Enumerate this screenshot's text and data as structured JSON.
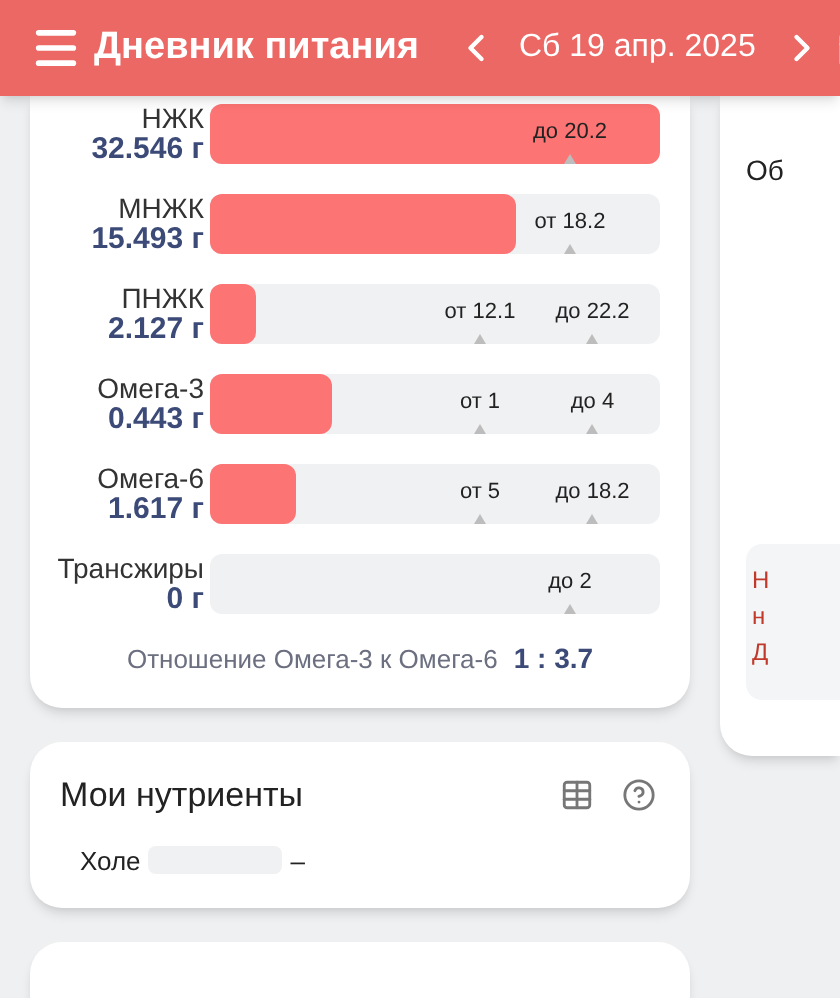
{
  "header": {
    "title": "Дневник питания",
    "date": "Сб 19 апр. 2025"
  },
  "fats": [
    {
      "name": "НЖК",
      "amount": "32.546 г",
      "level": 1,
      "markers": [
        {
          "label": "до 20.2",
          "level": 0.8
        }
      ]
    },
    {
      "name": "МНЖК",
      "amount": "15.493 г",
      "level": 0.68,
      "markers": [
        {
          "label": "от 18.2",
          "level": 0.8
        }
      ]
    },
    {
      "name": "ПНЖК",
      "amount": "2.127 г",
      "level": 0.1,
      "markers": [
        {
          "label": "от 12.1",
          "level": 0.6
        },
        {
          "label": "до 22.2",
          "level": 0.85
        }
      ]
    },
    {
      "name": "Омега-3",
      "amount": "0.443 г",
      "level": 0.27,
      "markers": [
        {
          "label": "от 1",
          "level": 0.6
        },
        {
          "label": "до 4",
          "level": 0.85
        }
      ]
    },
    {
      "name": "Омега-6",
      "amount": "1.617 г",
      "level": 0.19,
      "markers": [
        {
          "label": "от 5",
          "level": 0.6
        },
        {
          "label": "до 18.2",
          "level": 0.85
        }
      ]
    },
    {
      "name": "Трансжиры",
      "amount": "0 г",
      "level": 0,
      "markers": [
        {
          "label": "до 2",
          "level": 0.8
        }
      ]
    }
  ],
  "ratio": {
    "label": "Отношение Омега-3 к Омега-6",
    "value": "1 : 3.7"
  },
  "my_nutrients": {
    "title": "Мои нутриенты",
    "items": [
      {
        "name": "Холе",
        "value": "–"
      }
    ]
  },
  "side_panel": {
    "title": "Об",
    "notice_lines": [
      "Н",
      "н",
      "Д"
    ]
  }
}
